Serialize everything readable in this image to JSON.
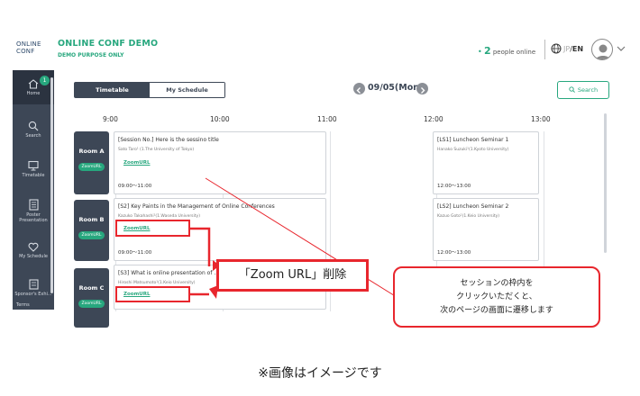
{
  "header": {
    "logo_line1": "ONLINE",
    "logo_line2": "CONF",
    "title": "ONLINE CONF DEMO",
    "subtitle": "DEMO PURPOSE ONLY",
    "online_count": "2",
    "online_label": "people online",
    "lang_jp": "JP",
    "lang_sep": "/",
    "lang_en": "EN"
  },
  "sidebar": {
    "badge": "1",
    "items": [
      {
        "label": "Home",
        "icon": "home-icon"
      },
      {
        "label": "Search",
        "icon": "search-icon"
      },
      {
        "label": "Timetable",
        "icon": "monitor-icon"
      },
      {
        "label": "Poster Presentation",
        "icon": "poster-icon"
      },
      {
        "label": "My Schedule",
        "icon": "heart-icon"
      },
      {
        "label": "Sponsor's Exhi...",
        "icon": "sponsor-icon"
      },
      {
        "label": "Terms",
        "icon": "terms-icon"
      }
    ]
  },
  "toolbar": {
    "tab_timetable": "Timetable",
    "tab_myschedule": "My Schedule",
    "date": "09/05(Mon)",
    "search_label": "Search"
  },
  "timeaxis": [
    "9:00",
    "10:00",
    "11:00",
    "12:00",
    "13:00"
  ],
  "rooms": [
    {
      "name": "Room A",
      "zoom": "ZoomURL"
    },
    {
      "name": "Room B",
      "zoom": "ZoomURL"
    },
    {
      "name": "Room C",
      "zoom": "ZoomURL"
    }
  ],
  "sessions": [
    {
      "title": "[Session No.] Here is the sessino title",
      "speaker": "Sato Taro¹ (1.The University of Tokyo)",
      "zoom": "ZoomURL",
      "time": "09:00～11:00"
    },
    {
      "title": "[S2] Key Paints in the Management of Online Conferences",
      "speaker": "Kazuko Takahashi¹(1.Waseda University)",
      "zoom": "ZoomURL",
      "time": "09:00～11:00"
    },
    {
      "title": "[S3] What is online presentation of ...",
      "speaker": "Hiroshi Matsumoto¹(1.Keio University)",
      "zoom": "ZoomURL",
      "time": ""
    },
    {
      "title": "[LS1] Luncheon Seminar 1",
      "speaker": "Hanako Suzuki¹(1.Kyoto University)",
      "zoom": "",
      "time": "12:00～13:00"
    },
    {
      "title": "[LS2] Luncheon Seminar 2",
      "speaker": "Kazuo Goto¹(1.Keio University)",
      "zoom": "",
      "time": "12:00～13:00"
    }
  ],
  "annotations": {
    "delete_label": "「Zoom URL」削除",
    "note_line1": "セッションの枠内を",
    "note_line2": "クリックいただくと、",
    "note_line3": "次のページの画面に遷移します",
    "caption": "※画像はイメージです"
  },
  "colors": {
    "accent": "#27a77e",
    "sidebar": "#3d4756",
    "annotation_red": "#e8262d"
  }
}
